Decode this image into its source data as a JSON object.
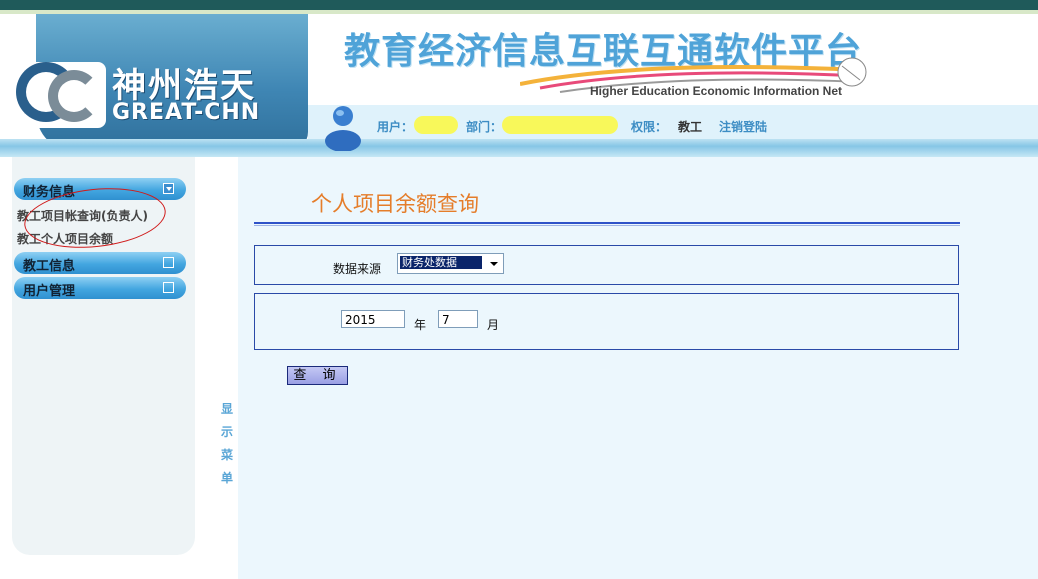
{
  "header": {
    "logo_cn": "神州浩天",
    "logo_en": "GREAT-CHN",
    "site_title": "教育经济信息互联互通软件平台",
    "site_subtitle": "Higher Education Economic Information Net"
  },
  "userbar": {
    "user_label": "用户：",
    "dept_label": "部门：",
    "perm_label": "权限：",
    "perm_value": "教工",
    "logout": "注销登陆"
  },
  "sidebar": {
    "sections": [
      {
        "label": "财务信息",
        "expanded": true,
        "items": [
          "教工项目帐查询(负责人)",
          "教工个人项目余额"
        ]
      },
      {
        "label": "教工信息",
        "expanded": false
      },
      {
        "label": "用户管理",
        "expanded": false
      }
    ],
    "vertical_text": [
      "显",
      "示",
      "菜",
      "单"
    ]
  },
  "main": {
    "title": "个人项目余额查询",
    "source_label": "数据来源",
    "source_value": "财务处数据",
    "year_value": "2015",
    "year_label": "年",
    "month_value": "7",
    "month_label": "月",
    "query_button": "查 询"
  },
  "colors": {
    "accent_orange": "#e57d2a",
    "nav_blue": "#43a6e0",
    "rule_blue": "#2e52c8",
    "annotation_red": "#d01a1a"
  }
}
